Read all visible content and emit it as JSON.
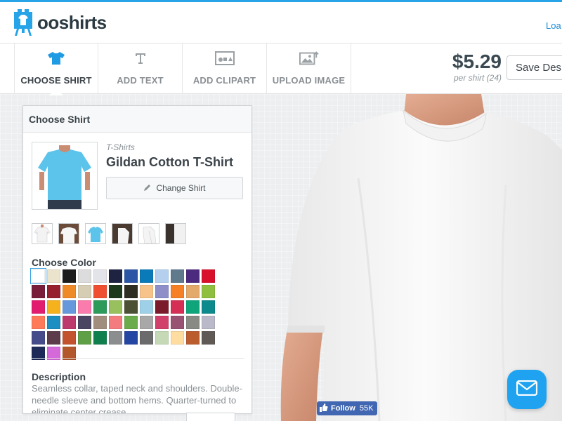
{
  "brand": {
    "name": "ooshirts",
    "accent": "#27a3e8"
  },
  "header": {
    "link": "Loa"
  },
  "toolbar": {
    "tools": [
      {
        "label": "CHOOSE SHIRT",
        "icon": "shirt-icon",
        "active": true
      },
      {
        "label": "ADD TEXT",
        "icon": "text-icon",
        "active": false
      },
      {
        "label": "ADD CLIPART",
        "icon": "clipart-icon",
        "active": false
      },
      {
        "label": "UPLOAD IMAGE",
        "icon": "upload-image-icon",
        "active": false
      }
    ],
    "price": "$5.29",
    "price_sub": "per shirt (24)",
    "save_label": "Save Des"
  },
  "panel": {
    "title": "Choose Shirt",
    "category": "T-Shirts",
    "product_name": "Gildan Cotton T-Shirt",
    "change_label": "Change Shirt",
    "color_title": "Choose Color",
    "selected_color_index": 0,
    "colors": [
      "#ffffff",
      "#ece3cc",
      "#1c1c1c",
      "#dcdcdc",
      "#e3e3ea",
      "#1d2340",
      "#2b56a6",
      "#0a7bb8",
      "#b5d0ef",
      "#5e7a8c",
      "#4c2a7e",
      "#d9102c",
      "#781e3b",
      "#96202e",
      "#ef8a28",
      "#d6cdb5",
      "#ef4f30",
      "#1e3a1c",
      "#2d2d22",
      "#f7c38a",
      "#8e8fc8",
      "#f58025",
      "#e3a96a",
      "#8fbf3f",
      "#e21c6f",
      "#f6b21c",
      "#6698dc",
      "#f97cac",
      "#2b9a5b",
      "#98c05c",
      "#4a5135",
      "#9ed1e8",
      "#7a1a2a",
      "#d52f55",
      "#0ea57b",
      "#0c8a8c",
      "#ff7a58",
      "#1c8ec1",
      "#bd3a6c",
      "#4a4561",
      "#a08d7e",
      "#f57c7e",
      "#6aab4c",
      "#a8a8a8",
      "#d0406b",
      "#9a5272",
      "#8a8a84",
      "#b9b9c9",
      "#464b8c",
      "#5c3b4a",
      "#c2532e",
      "#5f9f46",
      "#0f7f4e",
      "#8b8d8e",
      "#2545a2",
      "#6b6b6b",
      "#c5d9b7",
      "#ffdca0",
      "#ba5c2e",
      "#5f5a55",
      "#1e2b59",
      "#d569d9",
      "#b3582c"
    ],
    "description_title": "Description",
    "description": "Seamless collar, taped neck and shoulders. Double-needle sleeve and bottom hems. Quarter-turned to eliminate center crease."
  },
  "social": {
    "follow_label": "Follow",
    "follow_count": "55K"
  }
}
